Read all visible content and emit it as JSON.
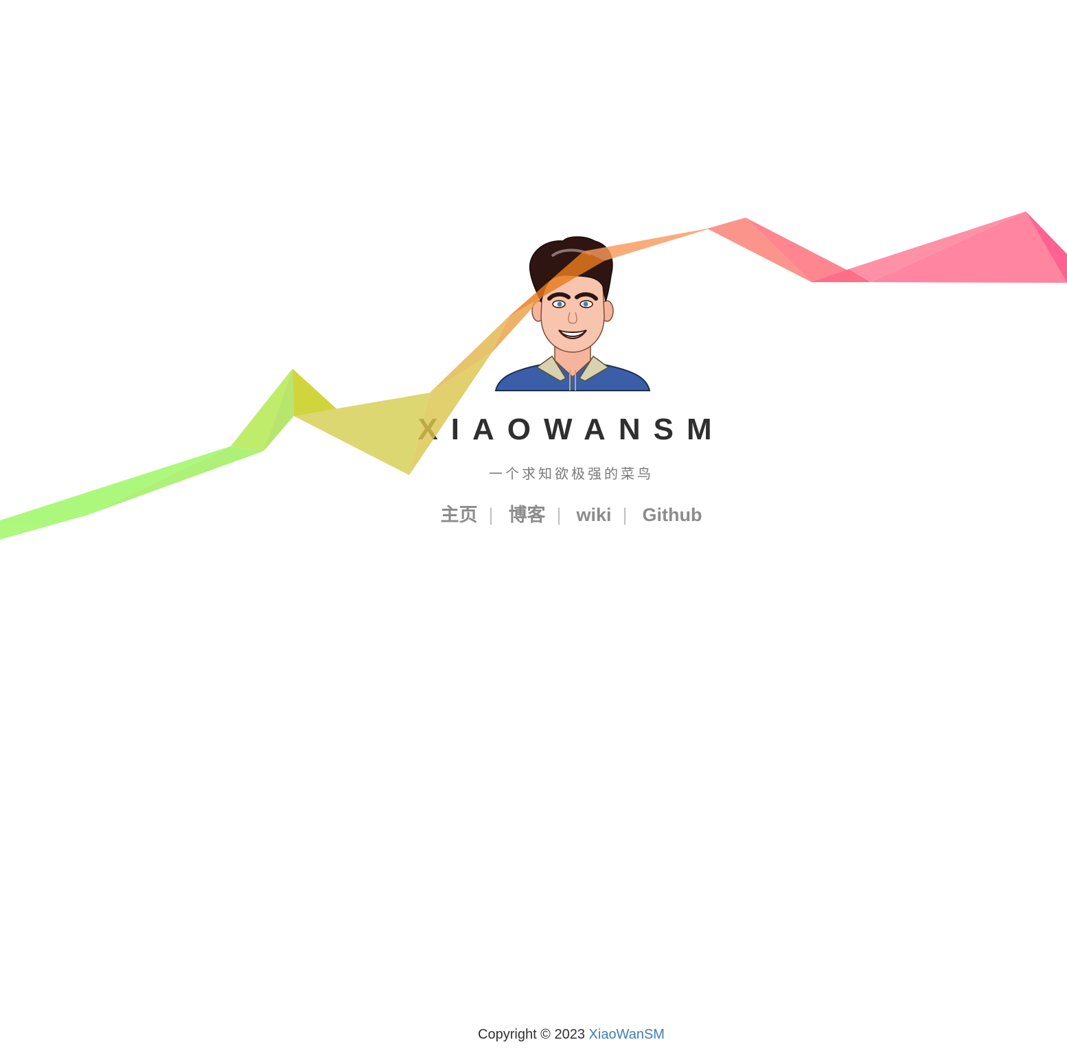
{
  "profile": {
    "title": "XIAOWANSM",
    "tagline": "一个求知欲极强的菜鸟"
  },
  "nav": {
    "items": [
      {
        "label": "主页"
      },
      {
        "label": "博客"
      },
      {
        "label": "wiki"
      },
      {
        "label": "Github"
      }
    ],
    "separator": "|"
  },
  "footer": {
    "copyright": "Copyright © 2023 ",
    "link_label": "XiaoWanSM"
  },
  "colors": {
    "title": "#2f2f2f",
    "tagline": "#7a7a7a",
    "nav_link": "#8c8c8c",
    "footer_link": "#3f7fb6",
    "ribbon_start": "#9bf760",
    "ribbon_mid": "#d4c41a",
    "ribbon_end": "#ff4f84"
  },
  "icons": {
    "avatar": "cartoon-portrait"
  }
}
